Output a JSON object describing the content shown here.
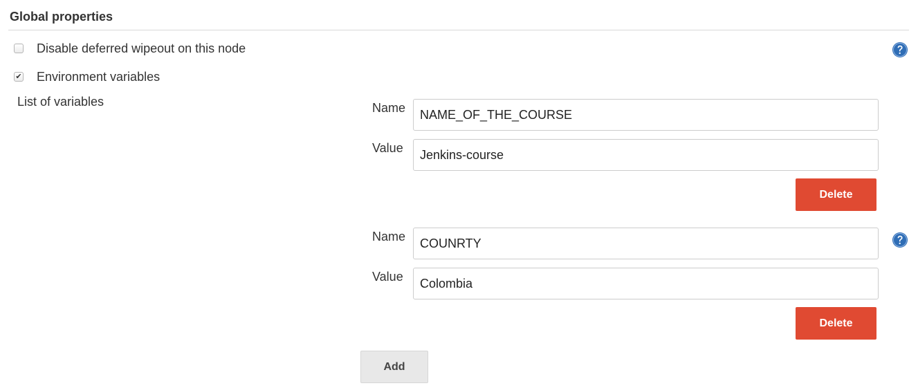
{
  "section": {
    "title": "Global properties"
  },
  "options": [
    {
      "label": "Disable deferred wipeout on this node",
      "checked": false
    },
    {
      "label": "Environment variables",
      "checked": true
    }
  ],
  "variables_list": {
    "label": "List of variables",
    "entries": [
      {
        "name_label": "Name",
        "name_value": "NAME_OF_THE_COURSE",
        "value_label": "Value",
        "value_value": "Jenkins-course",
        "delete_label": "Delete"
      },
      {
        "name_label": "Name",
        "name_value": "COUNRTY",
        "value_label": "Value",
        "value_value": "Colombia",
        "delete_label": "Delete"
      }
    ],
    "add_label": "Add"
  },
  "icons": {
    "help": "help-icon",
    "checkmark": "✔"
  },
  "colors": {
    "delete_button": "#e04a32",
    "help_icon": "#2f6db5",
    "add_button": "#e8e8e8"
  }
}
